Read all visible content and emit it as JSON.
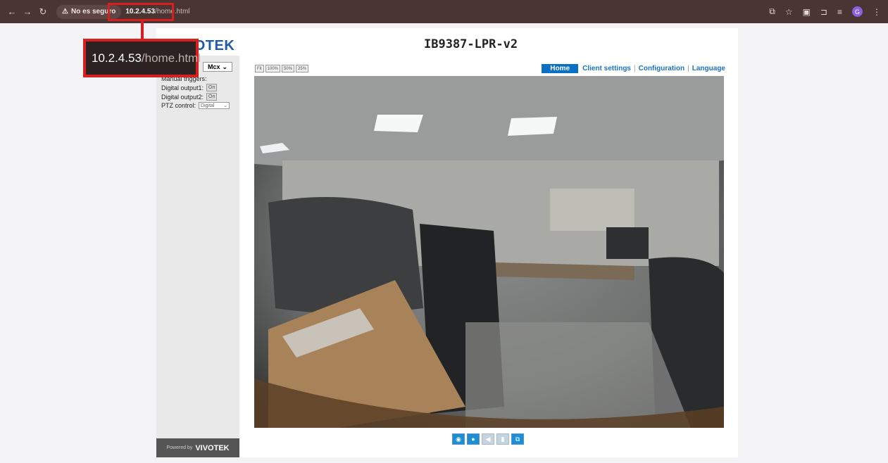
{
  "browser": {
    "security_label": "No es seguro",
    "url_host": "10.2.4.53",
    "url_path": "/home.html"
  },
  "callout": {
    "url_host": "10.2.4.53",
    "url_path": "/home.html"
  },
  "page": {
    "logo": "VIVOTEK",
    "title": "IB9387-LPR-v2",
    "nav": {
      "home": "Home",
      "client_settings": "Client settings",
      "configuration": "Configuration",
      "language": "Language"
    },
    "zoom_buttons": [
      "Fit",
      "100%",
      "50%",
      "25%"
    ],
    "sidebar": {
      "mode_value": "Mcx",
      "manual_trigger_label": "Manual triggers:",
      "digital_output1_label": "Digital output1:",
      "digital_output1_value": "On",
      "digital_output2_label": "Digital output2:",
      "digital_output2_value": "On",
      "ptz_control_label": "PTZ control:",
      "ptz_control_value": "Digital",
      "powered_by": "Powered by",
      "powered_brand": "VIVOTEK"
    },
    "controls": [
      "snapshot-icon",
      "record-icon",
      "volume-icon",
      "mic-icon",
      "fullscreen-icon"
    ]
  },
  "colors": {
    "chrome_bg": "#4a3532",
    "accent_red": "#d81f1f",
    "vivotek_blue": "#1e5aa8",
    "home_tab": "#0a70c6"
  }
}
